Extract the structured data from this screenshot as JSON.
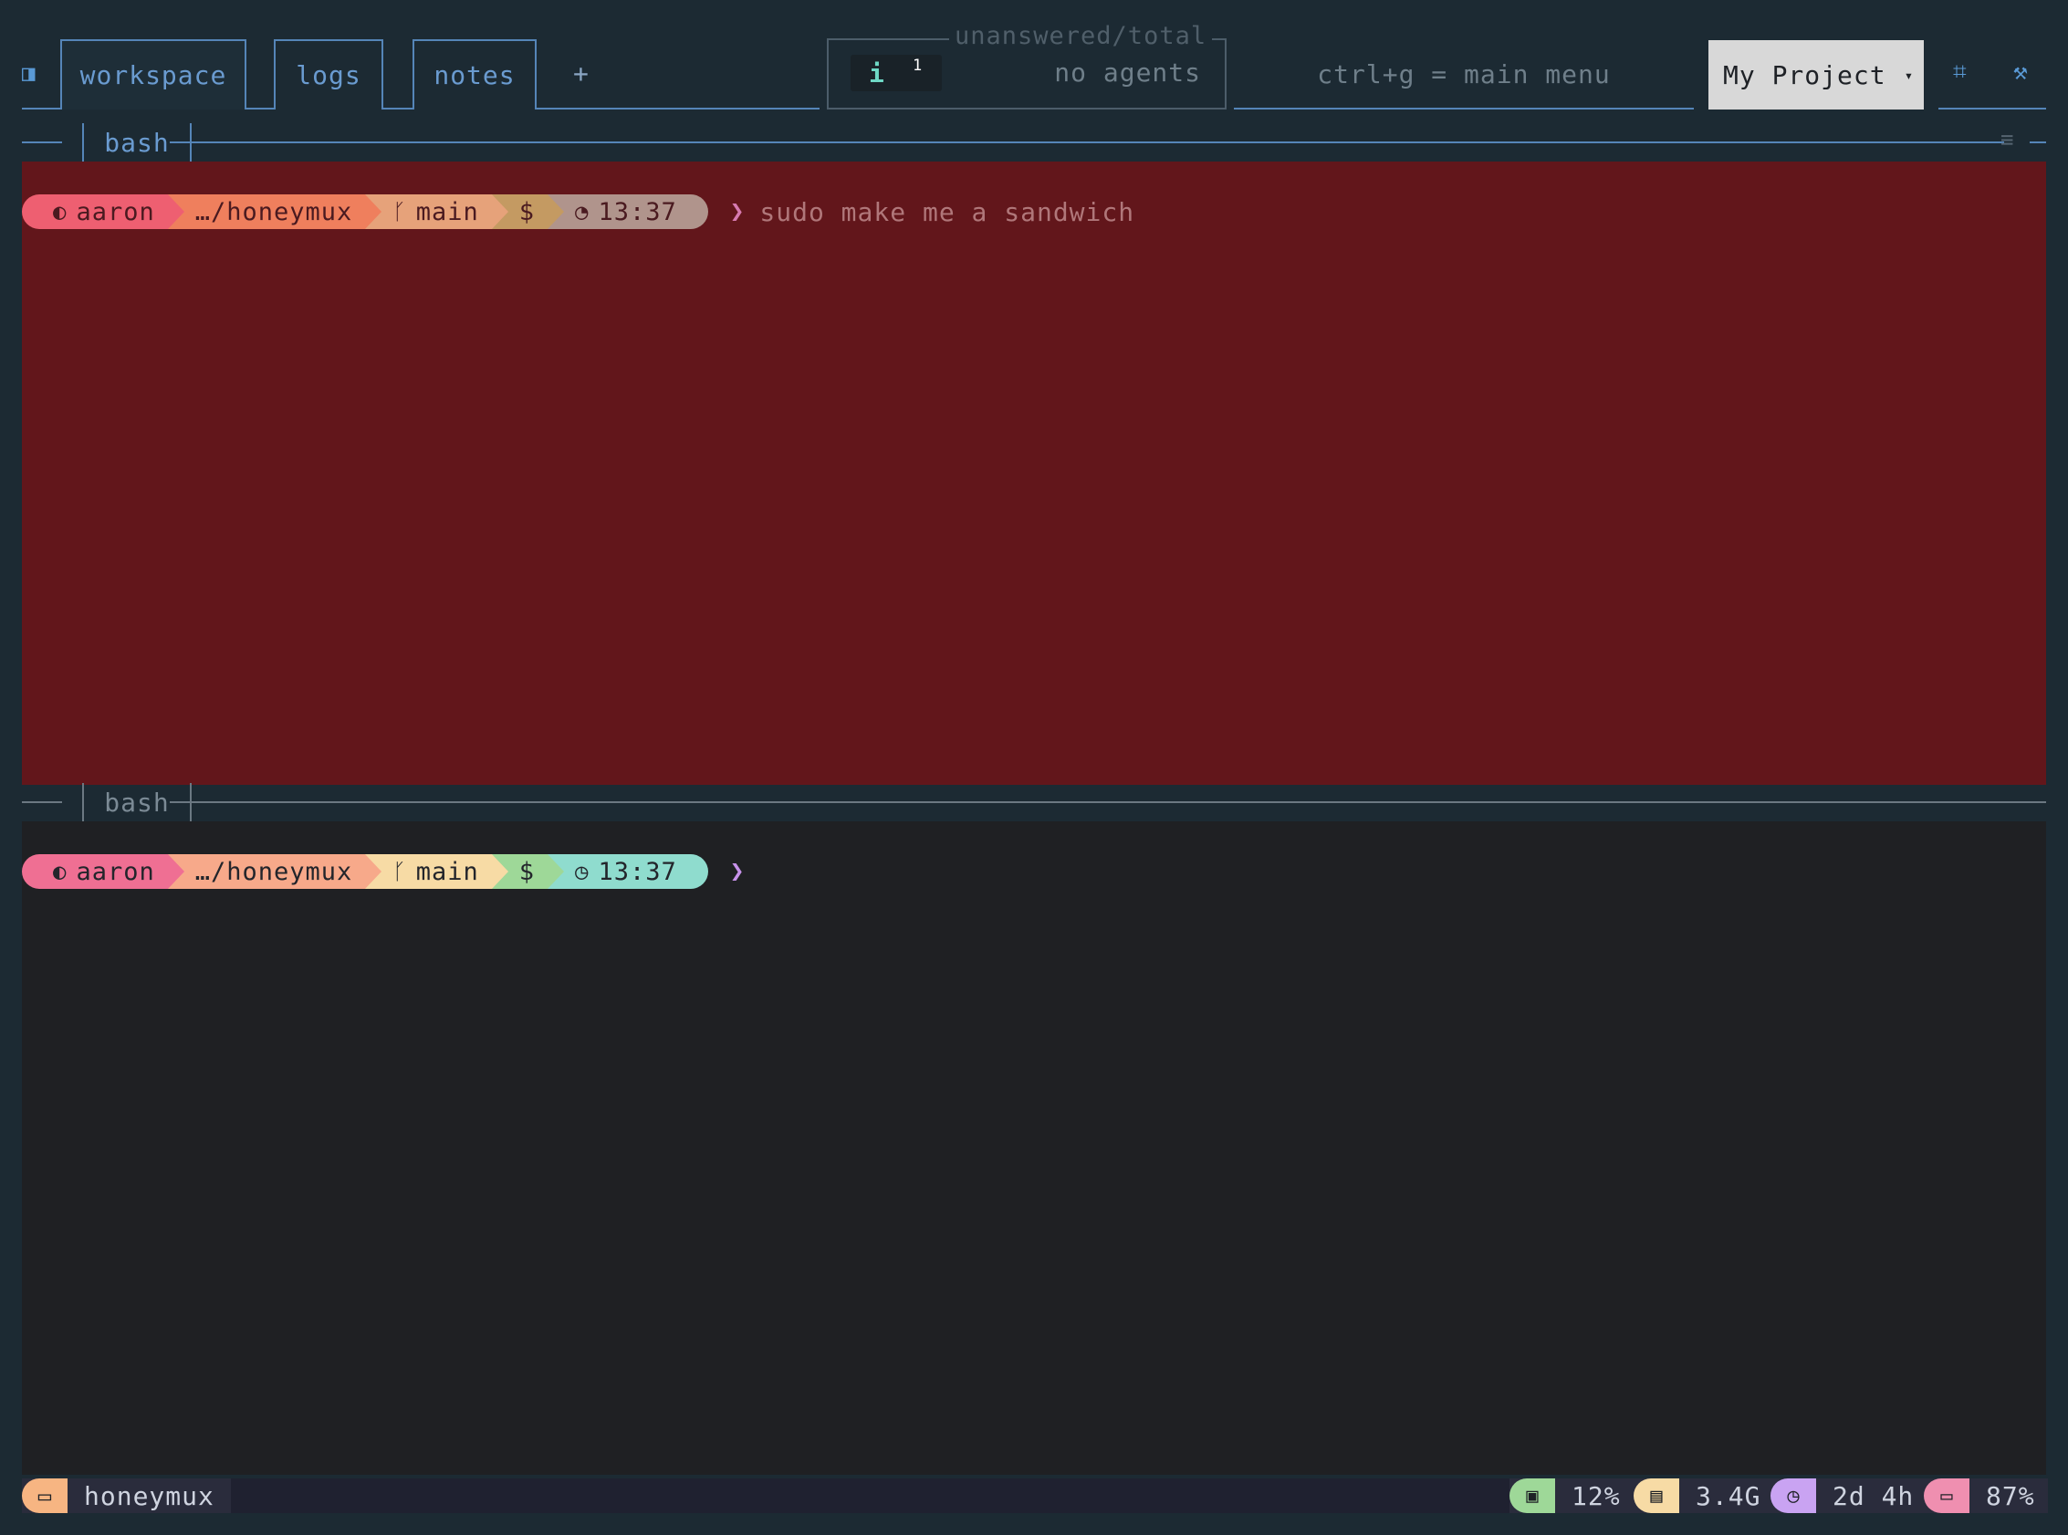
{
  "topbar": {
    "sidebar_toggle_icon": "sidebar-icon",
    "tabs": [
      {
        "label": "workspace",
        "active": true
      },
      {
        "label": "logs",
        "active": false
      },
      {
        "label": "notes",
        "active": false
      }
    ],
    "new_tab_label": "+",
    "agents": {
      "legend": "unanswered/total",
      "info_icon": "i",
      "count": "1",
      "status": "no agents"
    },
    "hint": "ctrl+g = main menu",
    "project": {
      "label": "My Project",
      "caret": "▾"
    },
    "layout_icon": "⌗",
    "tools_icon": "⚒"
  },
  "panes": [
    {
      "title": "bash",
      "menu_icon": "≡",
      "prompt": {
        "user": "aaron",
        "path": "…/honeymux",
        "branch": "main",
        "symbol": "$",
        "time": "13:37"
      },
      "caret": "❯",
      "command": "sudo make me a sandwich"
    },
    {
      "title": "bash",
      "prompt": {
        "user": "aaron",
        "path": "…/honeymux",
        "branch": "main",
        "symbol": "$",
        "time": "13:37"
      },
      "caret": "❯",
      "command": ""
    }
  ],
  "statusbar": {
    "session": "honeymux",
    "cpu": "12%",
    "memory": "3.4G",
    "uptime": "2d 4h",
    "battery": "87%"
  },
  "colors": {
    "background": "#1c2a33",
    "accent": "#5585b8",
    "alert_pane": "#62161b",
    "terminal": "#1f2023"
  }
}
